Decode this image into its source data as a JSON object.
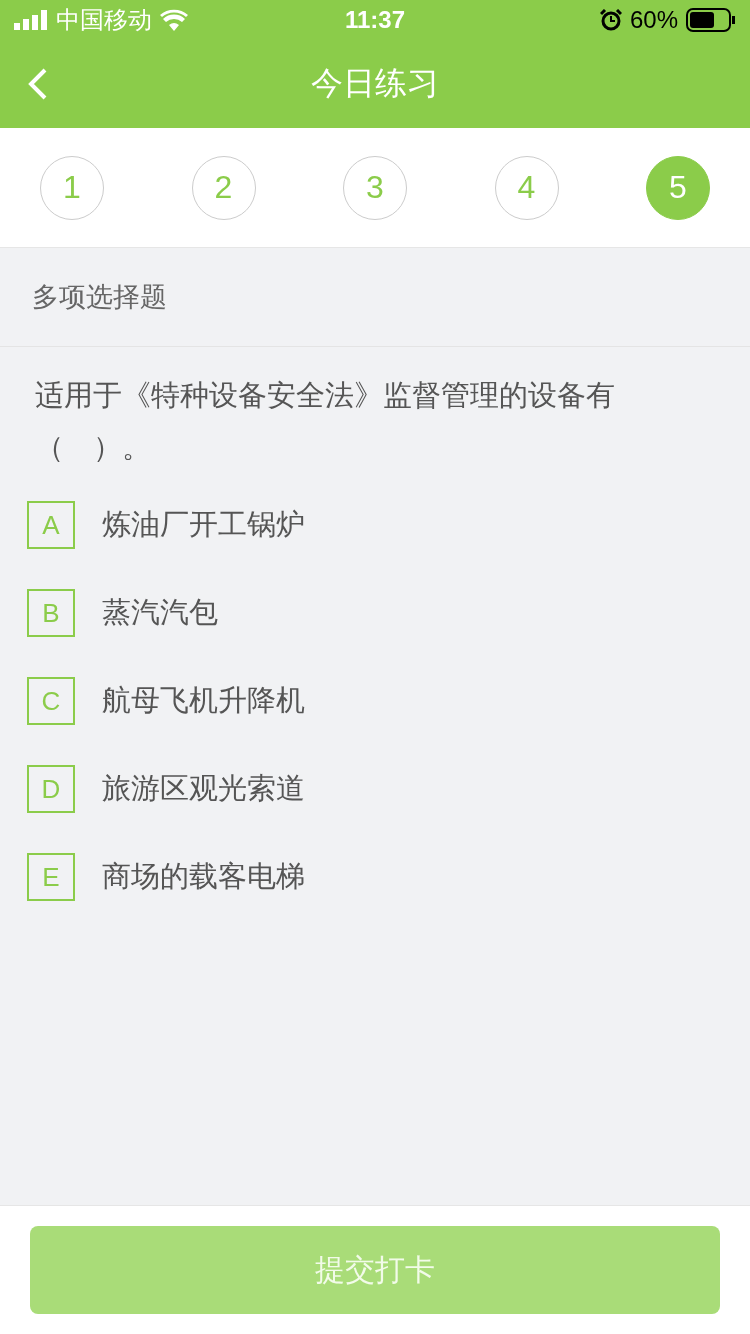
{
  "status_bar": {
    "carrier": "中国移动",
    "time": "11:37",
    "battery": "60%"
  },
  "nav": {
    "title": "今日练习"
  },
  "steps": [
    {
      "label": "1",
      "selected": false
    },
    {
      "label": "2",
      "selected": false
    },
    {
      "label": "3",
      "selected": false
    },
    {
      "label": "4",
      "selected": false
    },
    {
      "label": "5",
      "selected": true
    }
  ],
  "question": {
    "type": "多项选择题",
    "text": "适用于《特种设备安全法》监督管理的设备有（　）。",
    "options": [
      {
        "letter": "A",
        "text": "炼油厂开工锅炉",
        "selected": false
      },
      {
        "letter": "B",
        "text": "蒸汽汽包",
        "selected": false
      },
      {
        "letter": "C",
        "text": "航母飞机升降机",
        "selected": false
      },
      {
        "letter": "D",
        "text": "旅游区观光索道",
        "selected": false
      },
      {
        "letter": "E",
        "text": "商场的载客电梯",
        "selected": false
      }
    ]
  },
  "submit": {
    "label": "提交打卡",
    "disabled": true
  }
}
